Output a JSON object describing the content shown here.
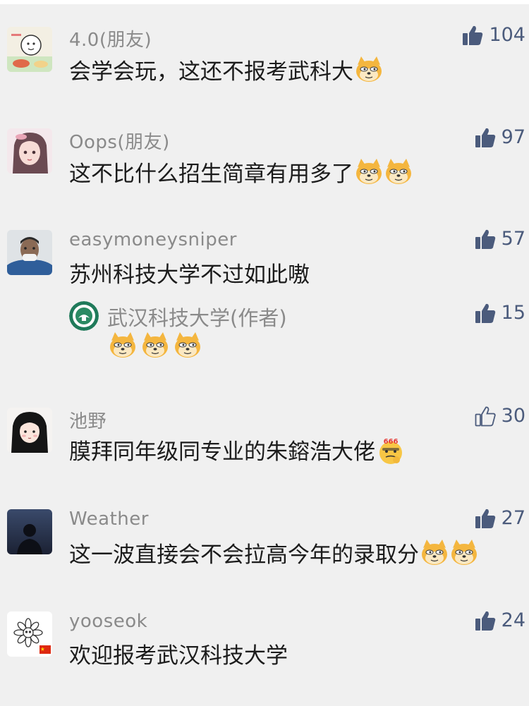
{
  "colors": {
    "background": "#f0f0f0",
    "name_text": "#8a8a8a",
    "body_text": "#1c1c1c",
    "like_icon": "#4b5b7c"
  },
  "comments": [
    {
      "name": "4.0(朋友)",
      "text": "会学会玩，这还不报考武科大",
      "likes": "104",
      "liked": true,
      "avatar_icon": "cartoon-avatar-icon",
      "emojis": [
        "doge-emoji"
      ]
    },
    {
      "name": "Oops(朋友)",
      "text": "这不比什么招生简章有用多了",
      "likes": "97",
      "liked": true,
      "avatar_icon": "anime-girl-avatar-icon",
      "emojis": [
        "doge-emoji",
        "doge-emoji"
      ]
    },
    {
      "name": "easymoneysniper",
      "text": "苏州科技大学不过如此嗷",
      "likes": "57",
      "liked": true,
      "avatar_icon": "man-avatar-icon",
      "emojis": [],
      "reply": {
        "name": "武汉科技大学(作者)",
        "likes": "15",
        "liked": true,
        "avatar_icon": "university-logo-icon",
        "emojis": [
          "doge-emoji",
          "doge-emoji",
          "doge-emoji"
        ]
      }
    },
    {
      "name": "池野",
      "text": "膜拜同年级同专业的朱鎔浩大佬",
      "likes": "30",
      "liked": false,
      "avatar_icon": "girl-black-hair-avatar-icon",
      "emojis": [
        "666-emoji"
      ]
    },
    {
      "name": "Weather",
      "text": "这一波直接会不会拉高今年的录取分",
      "likes": "27",
      "liked": true,
      "avatar_icon": "silhouette-avatar-icon",
      "emojis": [
        "doge-emoji",
        "doge-emoji"
      ]
    },
    {
      "name": "yooseok",
      "text": "欢迎报考武汉科技大学",
      "likes": "24",
      "liked": true,
      "avatar_icon": "flower-avatar-icon",
      "emojis": []
    }
  ]
}
